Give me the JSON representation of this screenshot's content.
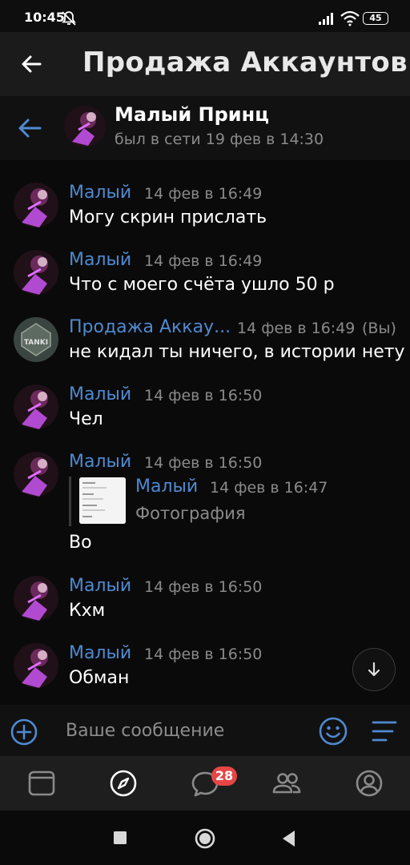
{
  "status_bar": {
    "time": "10:45",
    "battery": "45",
    "icons": [
      "mute-icon",
      "signal-icon",
      "wifi-icon",
      "battery-icon"
    ]
  },
  "group_header": {
    "title": "Продажа Аккаунтов Та"
  },
  "chat_header": {
    "name": "Малый Принц",
    "status": "был в сети 19 фев в 14:30"
  },
  "messages": [
    {
      "author": "Малый",
      "time": "14 фев в 16:49",
      "text": "Могу скрин прислать"
    },
    {
      "author": "Малый",
      "time": "14 фев в 16:49",
      "text": "Что с моего счёта ушло 50 р"
    },
    {
      "author": "Продажа Аккау...",
      "time": "14 фев в 16:49",
      "you_label": "(Вы)",
      "text": "не кидал ты ничего, в истории нету"
    },
    {
      "author": "Малый",
      "time": "14 фев в 16:50",
      "text": "Чел"
    },
    {
      "author": "Малый",
      "time": "14 фев в 16:50",
      "text": "Во",
      "forwarded": {
        "author": "Малый",
        "time": "14 фев в 16:47",
        "text": "Фотография"
      }
    },
    {
      "author": "Малый",
      "time": "14 фев в 16:50",
      "text": "Кхм"
    },
    {
      "author": "Малый",
      "time": "14 фев в 16:50",
      "text": "Обман"
    }
  ],
  "composer": {
    "placeholder": "Ваше сообщение"
  },
  "tabbar": {
    "messages_badge": "28"
  },
  "colors": {
    "accent": "#4f8ad0",
    "badge": "#e64646",
    "background": "#0a0a0a"
  }
}
